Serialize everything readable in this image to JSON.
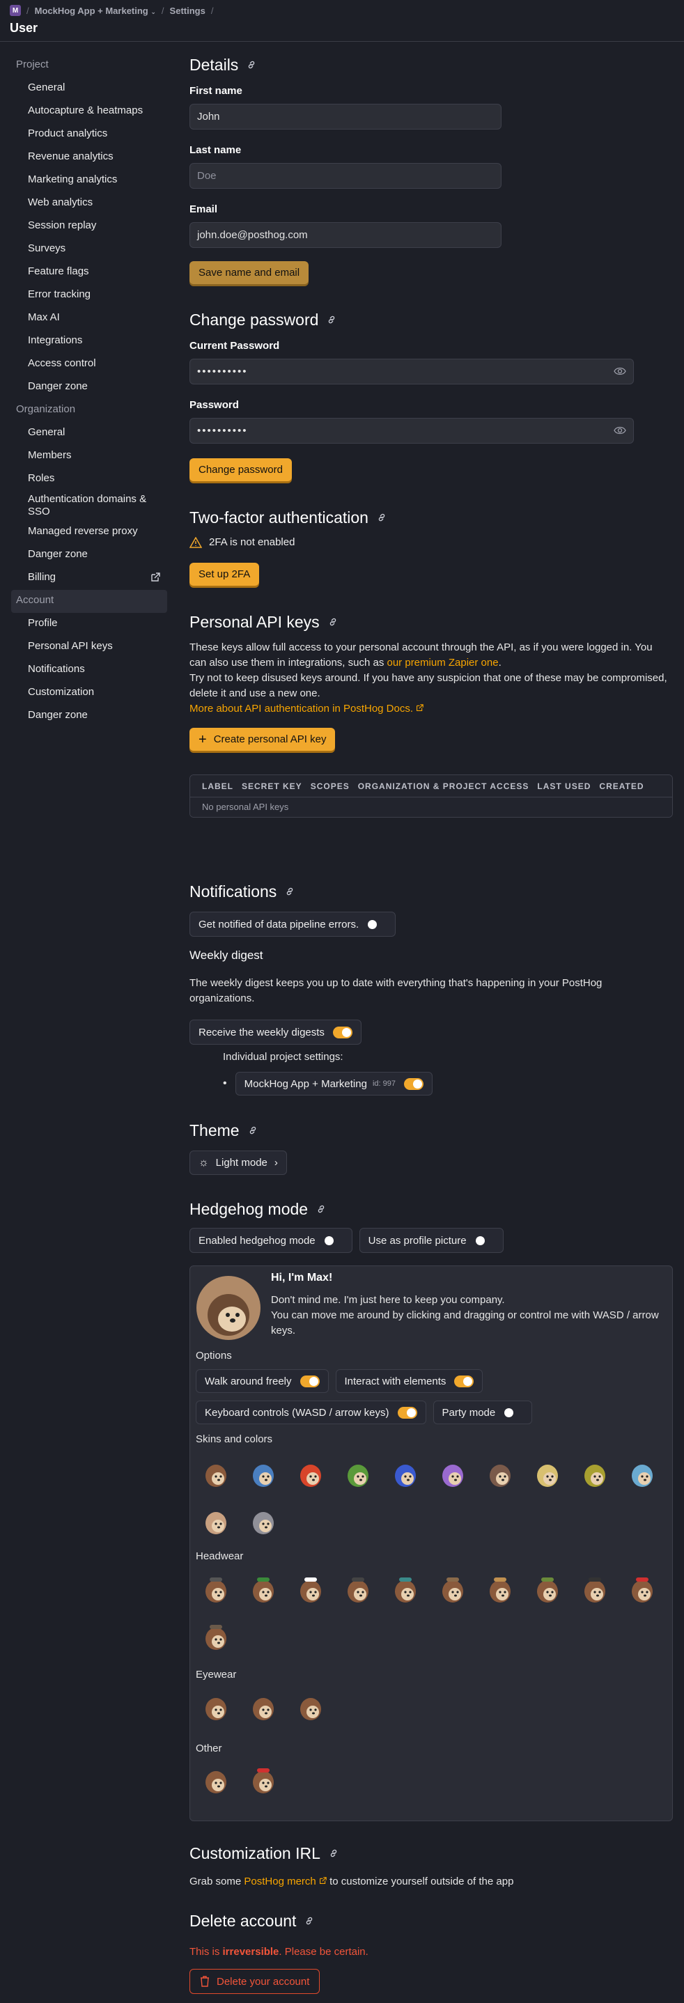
{
  "breadcrumb": {
    "badge": "M",
    "project": "MockHog App + Marketing",
    "settings": "Settings"
  },
  "page_title": "User",
  "sidebar": {
    "project_label": "Project",
    "project_items": [
      "General",
      "Autocapture & heatmaps",
      "Product analytics",
      "Revenue analytics",
      "Marketing analytics",
      "Web analytics",
      "Session replay",
      "Surveys",
      "Feature flags",
      "Error tracking",
      "Max AI",
      "Integrations",
      "Access control",
      "Danger zone"
    ],
    "org_label": "Organization",
    "org_items": [
      "General",
      "Members",
      "Roles",
      "Authentication domains & SSO",
      "Managed reverse proxy",
      "Danger zone",
      "Billing"
    ],
    "account_label": "Account",
    "account_items": [
      "Profile",
      "Personal API keys",
      "Notifications",
      "Customization",
      "Danger zone"
    ]
  },
  "details": {
    "title": "Details",
    "first_name_label": "First name",
    "first_name_value": "John",
    "last_name_label": "Last name",
    "last_name_placeholder": "Doe",
    "email_label": "Email",
    "email_value": "john.doe@posthog.com",
    "save_button": "Save name and email"
  },
  "password": {
    "title": "Change password",
    "current_label": "Current Password",
    "current_value": "••••••••••",
    "new_label": "Password",
    "new_value": "••••••••••",
    "button": "Change password"
  },
  "twofa": {
    "title": "Two-factor authentication",
    "status": "2FA is not enabled",
    "button": "Set up 2FA"
  },
  "api_keys": {
    "title": "Personal API keys",
    "desc1": "These keys allow full access to your personal account through the API, as if you were logged in. You can also use them in integrations, such as ",
    "desc1_link": "our premium Zapier one",
    "desc1_end": ".",
    "desc2": "Try not to keep disused keys around. If you have any suspicion that one of these may be compromised, delete it and use a new one.",
    "docs_link": "More about API authentication in PostHog Docs.",
    "create_button": "Create personal API key",
    "columns": [
      "LABEL",
      "SECRET KEY",
      "SCOPES",
      "ORGANIZATION & PROJECT ACCESS",
      "LAST USED",
      "CREATED"
    ],
    "empty": "No personal API keys"
  },
  "notifications": {
    "title": "Notifications",
    "pipeline_toggle": "Get notified of data pipeline errors.",
    "pipeline_on": false,
    "digest_title": "Weekly digest",
    "digest_desc": "The weekly digest keeps you up to date with everything that's happening in your PostHog organizations.",
    "digest_toggle": "Receive the weekly digests",
    "digest_on": true,
    "individual_label": "Individual project settings:",
    "project_name": "MockHog App + Marketing",
    "project_id": "id: 997",
    "project_on": true
  },
  "theme": {
    "title": "Theme",
    "button": "Light mode"
  },
  "hedgehog": {
    "title": "Hedgehog mode",
    "enable_toggle": "Enabled hedgehog mode",
    "enable_on": false,
    "profile_toggle": "Use as profile picture",
    "profile_on": false,
    "greeting": "Hi, I'm Max!",
    "intro1": "Don't mind me. I'm just here to keep you company.",
    "intro2": "You can move me around by clicking and dragging or control me with WASD / arrow keys.",
    "options_label": "Options",
    "opt_walk": "Walk around freely",
    "opt_walk_on": true,
    "opt_interact": "Interact with elements",
    "opt_interact_on": true,
    "opt_keyboard": "Keyboard controls (WASD / arrow keys)",
    "opt_keyboard_on": true,
    "opt_party": "Party mode",
    "opt_party_on": false,
    "skins_label": "Skins and colors",
    "skins": [
      "#8a5a3c",
      "#4a7fc0",
      "#d8452a",
      "#5a9a3a",
      "#3a5ad0",
      "#9a6ad0",
      "#7a5a4a",
      "#d8c070",
      "#a8a030",
      "#6aaad0",
      "#c8a080",
      "#909098"
    ],
    "headwear_label": "Headwear",
    "headwear": [
      "hat-1",
      "hat-2",
      "chef-hat",
      "hat-4",
      "hat-5",
      "hat-6",
      "hat-7",
      "hat-8",
      "hat-9",
      "santa-hat",
      "hat-11"
    ],
    "eyewear_label": "Eyewear",
    "eyewear": [
      "glasses-1",
      "glasses-2",
      "glasses-3"
    ],
    "other_label": "Other",
    "other": [
      "other-1",
      "scarf"
    ]
  },
  "customization": {
    "title": "Customization IRL",
    "text_pre": "Grab some ",
    "link": "PostHog merch",
    "text_post": " to customize yourself outside of the app"
  },
  "delete": {
    "title": "Delete account",
    "warn_pre": "This is ",
    "warn_bold": "irreversible",
    "warn_post": ". Please be certain.",
    "button": "Delete your account"
  },
  "colors": {
    "accent": "#f1a82c",
    "danger": "#f2553a",
    "bg": "#1d1f27"
  }
}
